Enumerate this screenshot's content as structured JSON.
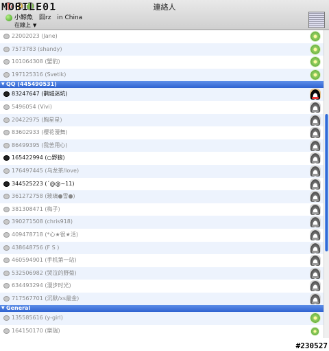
{
  "watermark": "MOBILE01",
  "window": {
    "title": "連絡人"
  },
  "account": {
    "name": "小鯨魚　囧rz　in China",
    "status": "在線上"
  },
  "groups": [
    {
      "label": "QQ (445490531)"
    },
    {
      "label": "General"
    }
  ],
  "contacts_top": [
    {
      "text": "22002023 (Jane)",
      "icon": "flower-icon"
    },
    {
      "text": "7573783 (shandy)",
      "icon": "flower-icon"
    },
    {
      "text": "101064308 (蟹豹)",
      "icon": "flower-icon"
    },
    {
      "text": "197125316 (Svetik)",
      "icon": "flower-icon"
    }
  ],
  "contacts_qq": [
    {
      "text": "83247647 (鹊城迷坑)",
      "online": true
    },
    {
      "text": "5496054 (Vivi)"
    },
    {
      "text": "20422975 (胸星星)"
    },
    {
      "text": "83602933 (櫻花漫舞)"
    },
    {
      "text": "86499395 (我苦用心)"
    },
    {
      "text": "165422994 (○野狼)",
      "online": true
    },
    {
      "text": "176497445 (乌龙茶/love)"
    },
    {
      "text": "344525223 (´@@~11)",
      "online": true
    },
    {
      "text": "361272758 (玻璃●雪●)"
    },
    {
      "text": "381308471 (梅子)"
    },
    {
      "text": "390271508 (chris918)"
    },
    {
      "text": "409478718 (*心★很★活)"
    },
    {
      "text": "438648756 (F S )"
    },
    {
      "text": "460594901 (手机第一站)"
    },
    {
      "text": "532506982 (哭泣的野菊)"
    },
    {
      "text": "634493294 (漫步时光)"
    },
    {
      "text": "717567701 (沉默/xs最金)"
    }
  ],
  "contacts_general": [
    {
      "text": "135585616 (y-girl)",
      "icon": "flower-icon"
    },
    {
      "text": "164150170 (樂瑞)",
      "icon": "flower-icon"
    }
  ],
  "post_tag": "#230527",
  "colors": {
    "group_header": "#3b6fd8",
    "row_stripe": "#edf3fd",
    "scroll_thumb": "#2a5fd0"
  }
}
